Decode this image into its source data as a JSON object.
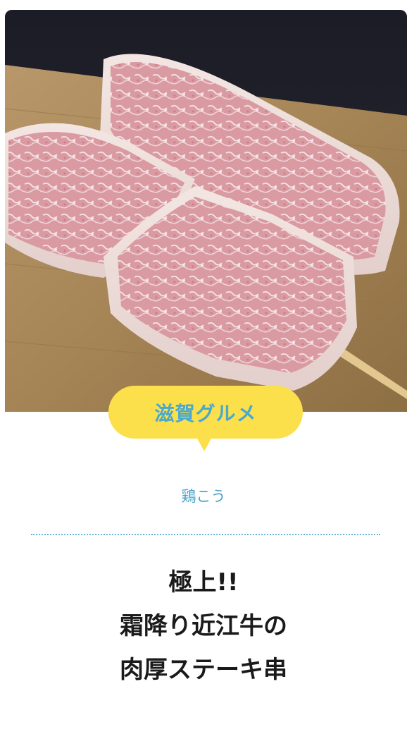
{
  "article": {
    "image_alt": "霜降り近江牛の肉厚ステーキ串",
    "category_badge": "滋賀グルメ",
    "shop_name": "鶏こう",
    "title_lines": [
      "極上!!",
      "霜降り近江牛の",
      "肉厚ステーキ串"
    ]
  },
  "colors": {
    "badge_background": "#fbe04b",
    "badge_text": "#4aa8cf",
    "shop_name": "#4aa2c9",
    "divider": "#6cb5d6",
    "title": "#1a1a1a"
  }
}
